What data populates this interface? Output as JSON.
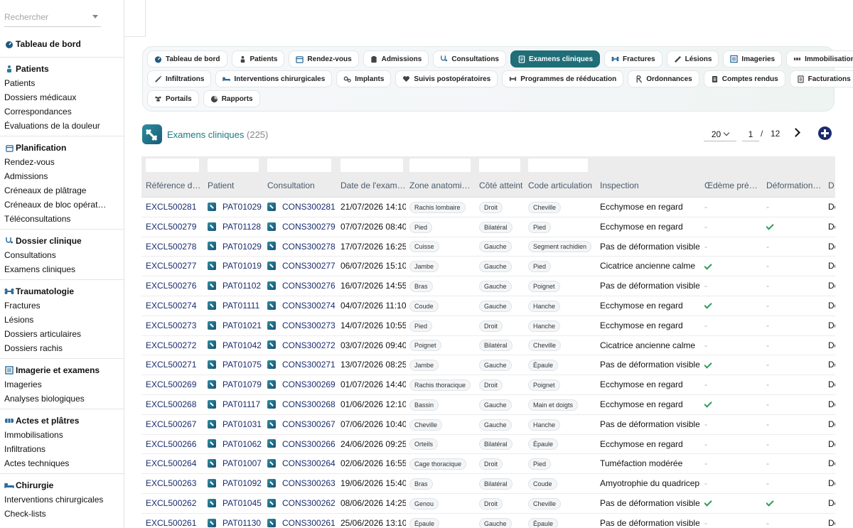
{
  "sidebar": {
    "search_placeholder": "Rechercher",
    "sections": [
      {
        "title": "Tableau de bord",
        "icon": "gauge-icon",
        "items": []
      },
      {
        "title": "Patients",
        "icon": "users-icon",
        "items": [
          "Patients",
          "Dossiers médicaux",
          "Correspondances",
          "Évaluations de la douleur"
        ]
      },
      {
        "title": "Planification",
        "icon": "calendar-icon",
        "items": [
          "Rendez-vous",
          "Admissions",
          "Créneaux de plâtrage",
          "Créneaux de bloc opérat…",
          "Téléconsultations"
        ]
      },
      {
        "title": "Dossier clinique",
        "icon": "stethoscope-icon",
        "items": [
          "Consultations",
          "Examens cliniques"
        ]
      },
      {
        "title": "Traumatologie",
        "icon": "bone-icon",
        "items": [
          "Fractures",
          "Lésions",
          "Dossiers articulaires",
          "Dossiers rachis"
        ]
      },
      {
        "title": "Imagerie et examens",
        "icon": "xray-icon",
        "items": [
          "Imageries",
          "Analyses biologiques"
        ]
      },
      {
        "title": "Actes et plâtres",
        "icon": "bandage-icon",
        "items": [
          "Immobilisations",
          "Infiltrations",
          "Actes techniques"
        ]
      },
      {
        "title": "Chirurgie",
        "icon": "bed-icon",
        "items": [
          "Interventions chirurgicales",
          "Check-lists"
        ]
      }
    ]
  },
  "tabs": [
    [
      {
        "label": "Tableau de bord",
        "icon": "gauge-icon"
      },
      {
        "label": "Patients",
        "icon": "user-icon"
      },
      {
        "label": "Rendez-vous",
        "icon": "calendar-icon"
      },
      {
        "label": "Admissions",
        "icon": "clipboard-icon"
      },
      {
        "label": "Consultations",
        "icon": "stethoscope-icon"
      },
      {
        "label": "Examens cliniques",
        "icon": "exam-icon",
        "active": true
      },
      {
        "label": "Fractures",
        "icon": "bone-icon"
      },
      {
        "label": "Lésions",
        "icon": "bandaid-icon"
      },
      {
        "label": "Imageries",
        "icon": "xray-icon"
      },
      {
        "label": "Immobilisations",
        "icon": "splint-icon"
      }
    ],
    [
      {
        "label": "Infiltrations",
        "icon": "syringe-icon"
      },
      {
        "label": "Interventions chirurgicales",
        "icon": "bed-icon"
      },
      {
        "label": "Implants",
        "icon": "gears-icon"
      },
      {
        "label": "Suivis postopératoires",
        "icon": "heart-icon"
      },
      {
        "label": "Programmes de rééducation",
        "icon": "dumbbell-icon"
      },
      {
        "label": "Ordonnances",
        "icon": "prescription-icon"
      },
      {
        "label": "Comptes rendus",
        "icon": "document-icon"
      },
      {
        "label": "Facturations",
        "icon": "invoice-icon"
      }
    ],
    [
      {
        "label": "Portails",
        "icon": "people-icon"
      },
      {
        "label": "Rapports",
        "icon": "pie-icon"
      }
    ]
  ],
  "page": {
    "title": "Examens cliniques",
    "count": "(225)",
    "page_size": "20",
    "page_current": "1",
    "page_sep": "/",
    "page_total": "12"
  },
  "table": {
    "headers": [
      "Référence d…",
      "Patient",
      "Consultation",
      "Date de l'examen",
      "Zone anatomique",
      "Côté atteint",
      "Code articulation",
      "Inspection",
      "Œdème prés…",
      "Déformation …",
      "D"
    ],
    "rows": [
      [
        "EXCL500281",
        "PAT01029",
        "CONS300281",
        "21/07/2026 14:10",
        "Rachis lombaire",
        "Droit",
        "Cheville",
        "Ecchymose en regard",
        "-",
        "-",
        "Do"
      ],
      [
        "EXCL500279",
        "PAT01128",
        "CONS300279",
        "07/07/2026 08:40",
        "Pied",
        "Bilatéral",
        "Pied",
        "Ecchymose en regard",
        "-",
        "check",
        "Do"
      ],
      [
        "EXCL500278",
        "PAT01029",
        "CONS300278",
        "17/07/2026 16:25",
        "Cuisse",
        "Gauche",
        "Segment rachidien",
        "Pas de déformation visible",
        "-",
        "-",
        "Do"
      ],
      [
        "EXCL500277",
        "PAT01019",
        "CONS300277",
        "06/07/2026 15:10",
        "Jambe",
        "Gauche",
        "Pied",
        "Cicatrice ancienne calme",
        "check",
        "-",
        "Do"
      ],
      [
        "EXCL500276",
        "PAT01102",
        "CONS300276",
        "16/07/2026 14:55",
        "Bras",
        "Gauche",
        "Poignet",
        "Pas de déformation visible",
        "-",
        "-",
        "Do"
      ],
      [
        "EXCL500274",
        "PAT01111",
        "CONS300274",
        "04/07/2026 11:10",
        "Coude",
        "Gauche",
        "Hanche",
        "Ecchymose en regard",
        "check",
        "-",
        "Do"
      ],
      [
        "EXCL500273",
        "PAT01021",
        "CONS300273",
        "14/07/2026 10:55",
        "Pied",
        "Droit",
        "Hanche",
        "Ecchymose en regard",
        "-",
        "-",
        "Do"
      ],
      [
        "EXCL500272",
        "PAT01042",
        "CONS300272",
        "03/07/2026 09:40",
        "Poignet",
        "Bilatéral",
        "Cheville",
        "Cicatrice ancienne calme",
        "-",
        "-",
        "Do"
      ],
      [
        "EXCL500271",
        "PAT01075",
        "CONS300271",
        "13/07/2026 08:25",
        "Jambe",
        "Gauche",
        "Épaule",
        "Pas de déformation visible",
        "check",
        "-",
        "Do"
      ],
      [
        "EXCL500269",
        "PAT01079",
        "CONS300269",
        "01/07/2026 14:40",
        "Rachis thoracique",
        "Droit",
        "Poignet",
        "Ecchymose en regard",
        "-",
        "-",
        "Do"
      ],
      [
        "EXCL500268",
        "PAT01117",
        "CONS300268",
        "01/06/2026 12:10",
        "Bassin",
        "Gauche",
        "Main et doigts",
        "Ecchymose en regard",
        "check",
        "-",
        "Do"
      ],
      [
        "EXCL500267",
        "PAT01031",
        "CONS300267",
        "07/06/2026 10:40",
        "Cheville",
        "Gauche",
        "Hanche",
        "Pas de déformation visible",
        "-",
        "-",
        "Do"
      ],
      [
        "EXCL500266",
        "PAT01062",
        "CONS300266",
        "24/06/2026 09:25",
        "Orteils",
        "Bilatéral",
        "Épaule",
        "Ecchymose en regard",
        "-",
        "-",
        "Do"
      ],
      [
        "EXCL500264",
        "PAT01007",
        "CONS300264",
        "02/06/2026 16:55",
        "Cage thoracique",
        "Droit",
        "Pied",
        "Tuméfaction modérée",
        "-",
        "-",
        "Do"
      ],
      [
        "EXCL500263",
        "PAT01092",
        "CONS300263",
        "19/06/2026 15:40",
        "Bras",
        "Bilatéral",
        "Coude",
        "Amyotrophie du quadriceps",
        "-",
        "-",
        "Do"
      ],
      [
        "EXCL500262",
        "PAT01045",
        "CONS300262",
        "08/06/2026 14:25",
        "Genou",
        "Droit",
        "Cheville",
        "Pas de déformation visible",
        "check",
        "check",
        "Do"
      ],
      [
        "EXCL500261",
        "PAT01130",
        "CONS300261",
        "25/06/2026 13:10",
        "Épaule",
        "Gauche",
        "Épaule",
        "Pas de déformation visible",
        "-",
        "-",
        "Do"
      ]
    ]
  },
  "colors": {
    "accent": "#1f6e78",
    "link": "#1a2c6e",
    "check": "#2e9a5a",
    "add_button": "#1a2c6e"
  }
}
